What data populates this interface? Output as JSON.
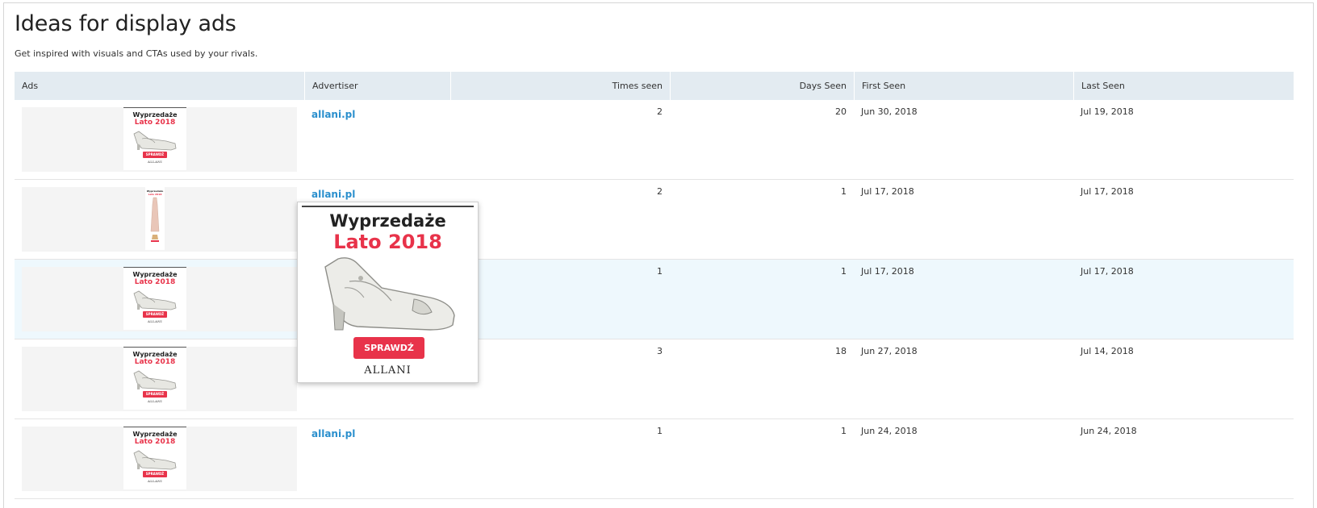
{
  "header": {
    "title": "Ideas for display ads",
    "subtitle": "Get inspired with visuals and CTAs used by your rivals."
  },
  "table": {
    "columns": [
      "Ads",
      "Advertiser",
      "Times seen",
      "Days Seen",
      "First Seen",
      "Last Seen"
    ],
    "rows": [
      {
        "advertiser": "allani.pl",
        "times_seen": "2",
        "days_seen": "20",
        "first_seen": "Jun 30, 2018",
        "last_seen": "Jul 19, 2018"
      },
      {
        "advertiser": "allani.pl",
        "times_seen": "2",
        "days_seen": "1",
        "first_seen": "Jul 17, 2018",
        "last_seen": "Jul 17, 2018"
      },
      {
        "advertiser": "",
        "times_seen": "1",
        "days_seen": "1",
        "first_seen": "Jul 17, 2018",
        "last_seen": "Jul 17, 2018"
      },
      {
        "advertiser": "",
        "times_seen": "3",
        "days_seen": "18",
        "first_seen": "Jun 27, 2018",
        "last_seen": "Jul 14, 2018"
      },
      {
        "advertiser": "allani.pl",
        "times_seen": "1",
        "days_seen": "1",
        "first_seen": "Jun 24, 2018",
        "last_seen": "Jun 24, 2018"
      }
    ]
  },
  "ad": {
    "headline": "Wyprzedaże",
    "subheadline": "Lato 2018",
    "cta": "SPRAWDŹ",
    "brand": "ALLANI",
    "sky_headline": "Wyprzedaże",
    "sky_subheadline": "Lato 2018"
  },
  "colors": {
    "accent": "#e8334a",
    "link": "#2a8fcd",
    "header_bg": "#e3ebf1",
    "hover_row_bg": "#eef8fd"
  }
}
